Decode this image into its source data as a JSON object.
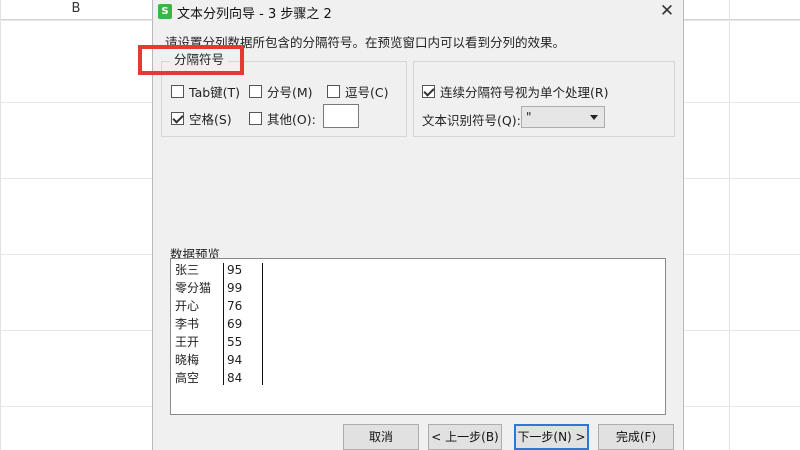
{
  "spreadsheet": {
    "column_label": "B"
  },
  "dialog": {
    "app_icon_letter": "S",
    "title": "文本分列向导 - 3 步骤之 2",
    "close_symbol": "✕",
    "instruction": "请设置分列数据所包含的分隔符号。在预览窗口内可以看到分列的效果。",
    "delimiters_group": {
      "legend": "分隔符号",
      "tab": {
        "label": "Tab键(T)",
        "checked": false
      },
      "semicolon": {
        "label": "分号(M)",
        "checked": false
      },
      "comma": {
        "label": "逗号(C)",
        "checked": false
      },
      "space": {
        "label": "空格(S)",
        "checked": true
      },
      "other": {
        "label": "其他(O):",
        "checked": false,
        "value": ""
      }
    },
    "options": {
      "consecutive": {
        "label": "连续分隔符号视为单个处理(R)",
        "checked": true
      },
      "text_qualifier_label": "文本识别符号(Q):",
      "text_qualifier_value": "\""
    },
    "preview": {
      "label": "数据预览",
      "rows": [
        {
          "name": "张三",
          "value": "95"
        },
        {
          "name": "零分猫",
          "value": "99"
        },
        {
          "name": "开心",
          "value": "76"
        },
        {
          "name": "李书",
          "value": "69"
        },
        {
          "name": "王开",
          "value": "55"
        },
        {
          "name": "晓梅",
          "value": "94"
        },
        {
          "name": "高空",
          "value": "84"
        }
      ]
    },
    "buttons": {
      "cancel": "取消",
      "back": "< 上一步(B)",
      "next": "下一步(N) >",
      "finish": "完成(F)"
    }
  },
  "colors": {
    "highlight_box": "#e53935",
    "app_icon": "#3bb54a",
    "default_button_border": "#2a7ad5"
  }
}
